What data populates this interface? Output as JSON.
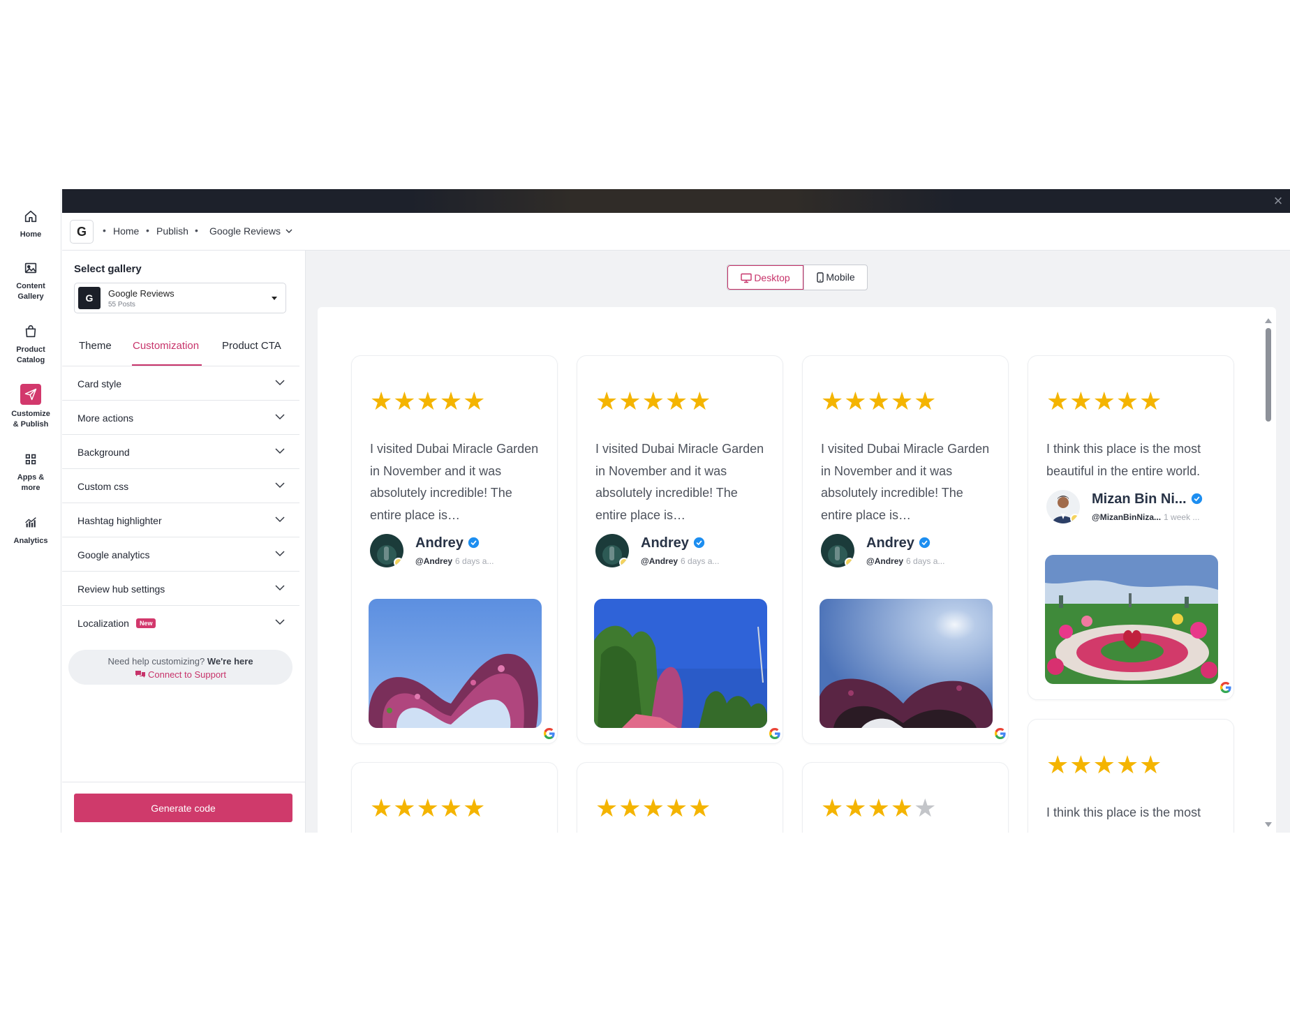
{
  "nav": {
    "items": [
      {
        "label": "Home",
        "icon": "home-icon"
      },
      {
        "label": "Content Gallery",
        "icon": "image-icon"
      },
      {
        "label": "Product Catalog",
        "icon": "shopping-bag-icon"
      },
      {
        "label": "Customize & Publish",
        "icon": "send-icon"
      },
      {
        "label": "Apps & more",
        "icon": "grid-icon"
      },
      {
        "label": "Analytics",
        "icon": "analytics-icon"
      }
    ],
    "active": "Customize & Publish"
  },
  "header": {
    "logo": "G",
    "breadcrumb": [
      "Home",
      "Publish",
      "Google Reviews"
    ]
  },
  "panel": {
    "select_gallery_title": "Select gallery",
    "gallery": {
      "logo": "G",
      "name": "Google Reviews",
      "count": "55 Posts"
    },
    "tabs": [
      "Theme",
      "Customization",
      "Product CTA"
    ],
    "active_tab": "Customization",
    "sections": [
      {
        "label": "Card style"
      },
      {
        "label": "More actions"
      },
      {
        "label": "Background"
      },
      {
        "label": "Custom css"
      },
      {
        "label": "Hashtag highlighter"
      },
      {
        "label": "Google analytics"
      },
      {
        "label": "Review hub settings"
      },
      {
        "label": "Localization",
        "badge": "New"
      }
    ],
    "help": {
      "text": "Need help customizing?",
      "emphasis": "We're here",
      "link": "Connect to Support"
    },
    "generate_label": "Generate code"
  },
  "preview": {
    "device_options": [
      "Desktop",
      "Mobile"
    ],
    "active_device": "Desktop",
    "cards": [
      {
        "rating": 5,
        "text": "I visited Dubai Miracle Garden in November and it was absolutely incredible! The entire place is…",
        "name": "Andrey",
        "handle": "@Andrey",
        "time": "6 days a..."
      },
      {
        "rating": 5,
        "text": "I visited Dubai Miracle Garden in November and it was absolutely incredible! The entire place is…",
        "name": "Andrey",
        "handle": "@Andrey",
        "time": "6 days a..."
      },
      {
        "rating": 5,
        "text": "I visited Dubai Miracle Garden in November and it was absolutely incredible! The entire place is…",
        "name": "Andrey",
        "handle": "@Andrey",
        "time": "6 days a..."
      },
      {
        "rating": 5,
        "text": "I think this place is the most beautiful in the entire world.",
        "name": "Mizan Bin Ni...",
        "handle": "@MizanBinNiza...",
        "time": "1 week ..."
      },
      {
        "rating": 5
      },
      {
        "rating": 5
      },
      {
        "rating": 4
      },
      {
        "rating": 5,
        "text": "I think this place is the most"
      }
    ]
  },
  "colors": {
    "accent": "#cf3a6b",
    "star": "#f4b400",
    "topbar": "#1d212b",
    "verified": "#1d8ef0"
  }
}
